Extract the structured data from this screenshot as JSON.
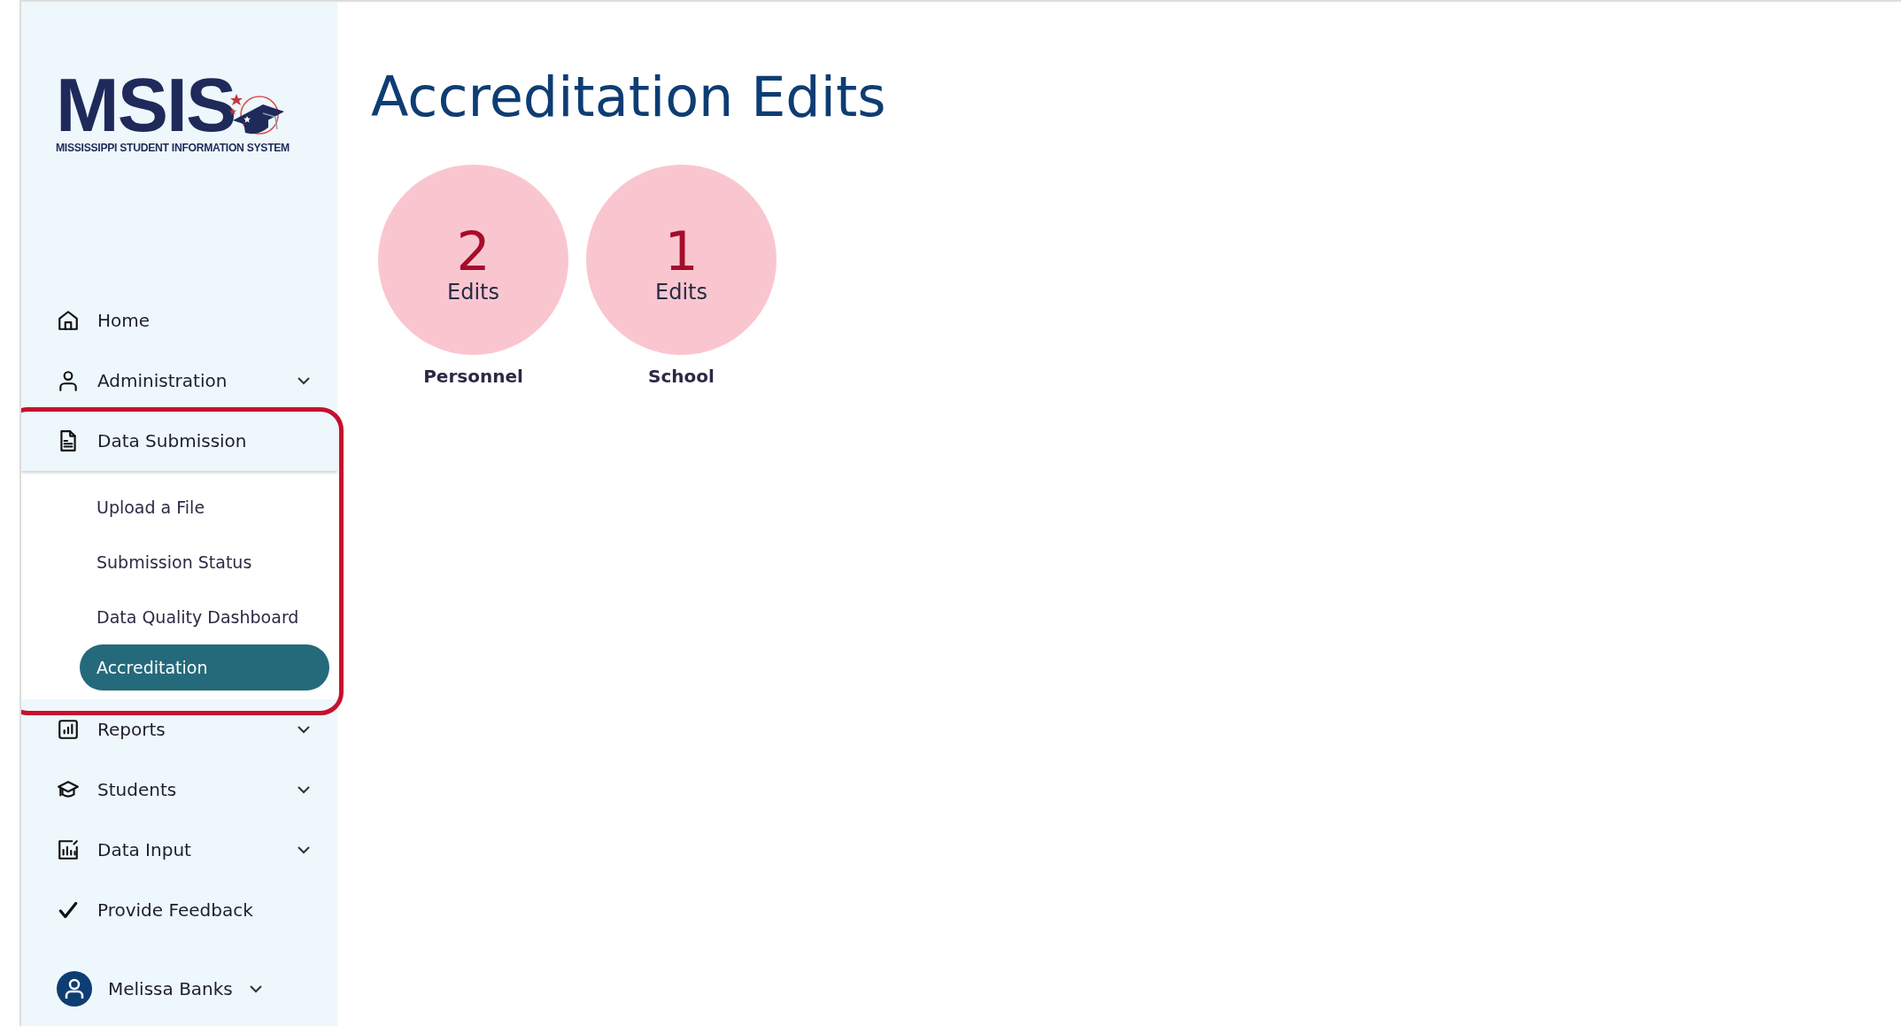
{
  "logo": {
    "title": "MSIS",
    "subtitle": "MISSISSIPPI STUDENT INFORMATION SYSTEM"
  },
  "nav": [
    {
      "label": "Home"
    },
    {
      "label": "Administration",
      "expanded": false
    },
    {
      "label": "Data Submission",
      "expanded": true,
      "highlighted": true,
      "children": [
        {
          "label": "Upload a File",
          "selected": false
        },
        {
          "label": "Submission Status",
          "selected": false
        },
        {
          "label": "Data Quality Dashboard",
          "selected": false
        },
        {
          "label": "Accreditation",
          "selected": true
        }
      ]
    },
    {
      "label": "Reports",
      "expanded": false
    },
    {
      "label": "Students",
      "expanded": false
    },
    {
      "label": "Data Input",
      "expanded": false
    },
    {
      "label": "Provide Feedback"
    }
  ],
  "user": {
    "name": "Melissa Banks"
  },
  "page": {
    "title": "Accreditation Edits"
  },
  "cards": [
    {
      "count": "2",
      "unit": "Edits",
      "label": "Personnel"
    },
    {
      "count": "1",
      "unit": "Edits",
      "label": "School"
    }
  ]
}
